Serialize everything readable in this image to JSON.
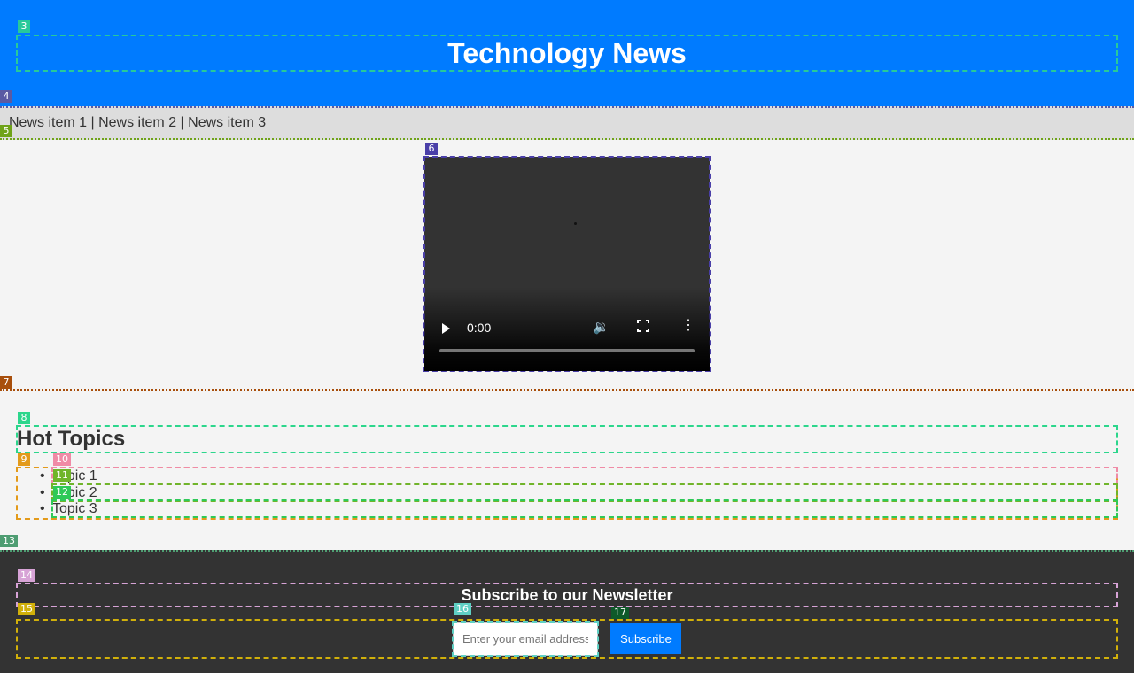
{
  "header": {
    "title": "Technology News"
  },
  "ticker": {
    "text": "News item 1 | News item 2 | News item 3"
  },
  "video": {
    "time": "0:00"
  },
  "hot_topics": {
    "heading": "Hot Topics",
    "items": [
      "Topic 1",
      "Topic 2",
      "Topic 3"
    ]
  },
  "newsletter": {
    "heading": "Subscribe to our Newsletter",
    "email_placeholder": "Enter your email address",
    "subscribe_label": "Subscribe"
  },
  "annotation_labels": [
    "3",
    "4",
    "5",
    "6",
    "7",
    "8",
    "9",
    "10",
    "11",
    "12",
    "13",
    "14",
    "15",
    "16",
    "17"
  ],
  "colors": {
    "header_bg": "#007bff",
    "ticker_bg": "#dddddd",
    "page_bg": "#f4f4f4",
    "footer_bg": "#333333",
    "accent": "#007bff"
  }
}
